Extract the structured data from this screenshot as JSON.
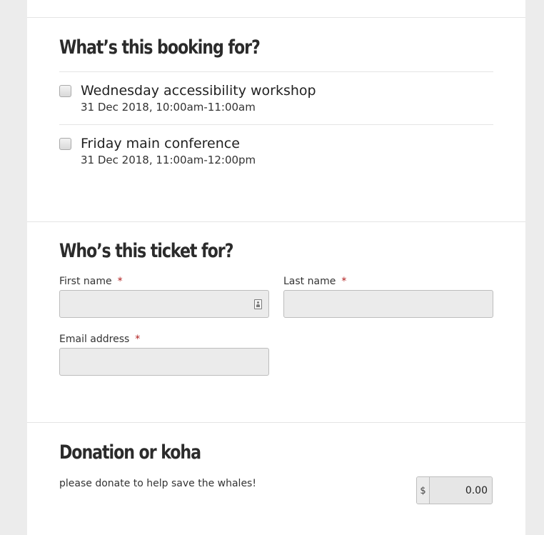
{
  "booking": {
    "heading": "What’s this booking for?",
    "options": [
      {
        "title": "Wednesday accessibility workshop",
        "date": "31 Dec 2018, 10:00am-11:00am",
        "checked": false
      },
      {
        "title": "Friday main conference",
        "date": "31 Dec 2018, 11:00am-12:00pm",
        "checked": false
      }
    ]
  },
  "ticket": {
    "heading": "Who’s this ticket for?",
    "first_name_label": "First name",
    "last_name_label": "Last name",
    "email_label": "Email address",
    "required_marker": "*",
    "first_name_value": "",
    "last_name_value": "",
    "email_value": ""
  },
  "donation": {
    "heading": "Donation or koha",
    "description": "please donate to help save the whales!",
    "currency_symbol": "$",
    "amount": "0.00"
  },
  "icons": {
    "autofill": "contact-card-icon"
  },
  "colors": {
    "required": "#b01c1c",
    "input_background": "#ebebeb",
    "page_background": "#ececec"
  }
}
